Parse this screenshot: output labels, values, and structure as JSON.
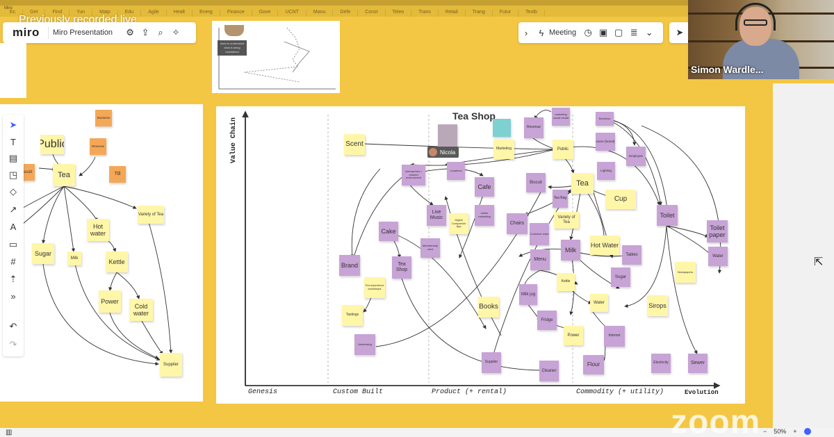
{
  "recording_overlay": "Previously recorded live",
  "browser_tabs": [
    "Ec",
    "Get",
    "Find",
    "Yun",
    "Matp",
    "Edu",
    "Agile",
    "Healt",
    "Energ",
    "Finance",
    "Gove",
    "UCNT",
    "Manu",
    "Defe",
    "Const",
    "Teleo",
    "Trans",
    "Retail",
    "Trang",
    "Futur",
    "Textb"
  ],
  "window_title": "Miro",
  "app": {
    "logo": "miro",
    "board_name": "Miro Presentation"
  },
  "toolbar_right": {
    "meeting_label": "Meeting"
  },
  "video": {
    "speaker": "Simon Wardle..."
  },
  "thumbnail": {
    "label": "need to understand what is being maintained"
  },
  "left_frame": {
    "notes": {
      "public": "Public",
      "tea": "Tea",
      "biscuit": "scuit",
      "business": "Business",
      "revenue": "Revenue",
      "till": "Till",
      "variety": "Variety of Tea",
      "hot_water": "Hot water",
      "sugar": "Sugar",
      "milk": "Milk",
      "kettle": "Kettle",
      "power": "Power",
      "cold_water": "Cold water",
      "supplier": "Supplier"
    }
  },
  "main_frame": {
    "title": "Tea Shop",
    "y_axis": "Value Chain",
    "x_axis": {
      "stages": [
        "Genesis",
        "Custom Built",
        "Product (+ rental)",
        "Commodity (+ utility)"
      ],
      "end": "Evolution"
    },
    "cursor_tag": "Nicola",
    "notes": {
      "scent": "Scent",
      "tea": "Tea",
      "cup": "Cup",
      "toilet": "Toilet",
      "toilet_paper": "Toilet paper",
      "water_right": "Water",
      "cafe": "Cafe",
      "biscuit": "Biscuit",
      "tea_bag": "Tea Bag",
      "chairs": "Chairs",
      "live_music": "Live Music",
      "cake": "Cake",
      "brand": "Brand",
      "tea_shop": "Tea Shop",
      "milk": "Milk",
      "menu": "Menu",
      "milk_jug": "Milk jug",
      "fridge": "Fridge",
      "power": "Power",
      "water_mid": "Water",
      "sugar": "Sugar",
      "tables": "Tables",
      "hot_water": "Hot Water",
      "variety": "Variety of Tea",
      "books": "Books",
      "sirops": "Sirops",
      "flour": "Flour",
      "sewer": "Sewer",
      "electricity": "Electricity",
      "internet": "Internet",
      "cleaner": "Cleaner",
      "supplier": "Supplier",
      "advertising": "Advertising",
      "tastings": "Tastings",
      "tea_experience": "Tea experience workshops",
      "kettle": "Kettle",
      "customer_want": "Customer want",
      "public": "Public",
      "marketing": "Marketing",
      "revenue": "Revenue",
      "business": "Business",
      "brand_name": "name (brand)",
      "employee": "Employee",
      "lighting": "Lighting",
      "newspapers": "Newspapers",
      "online_marketing": "online marketing",
      "digital_companion": "Digital Companion App",
      "atmosphere": "Atmosphere / relaxed environment",
      "membership_card": "Membership card",
      "marketing_social": "marketing social media",
      "locations": "Locations"
    }
  },
  "bottom": {
    "zoom_percent": "50%"
  },
  "watermark": "zoom"
}
